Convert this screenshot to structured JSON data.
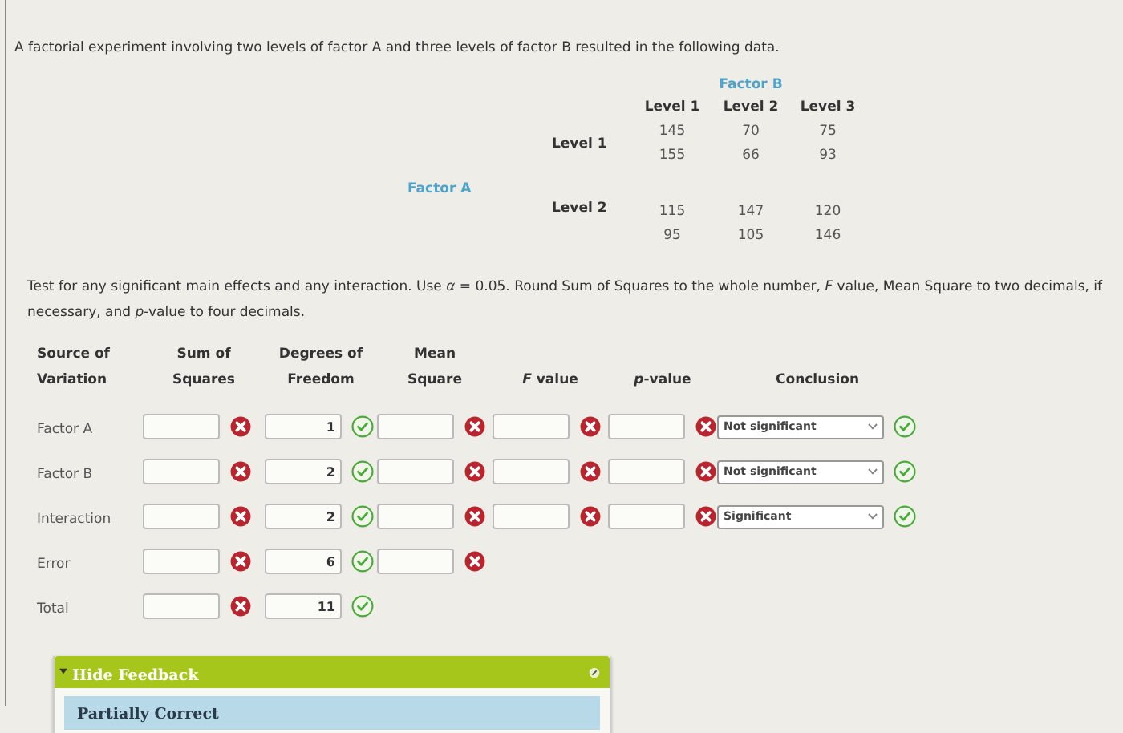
{
  "intro": "A factorial experiment involving two levels of factor A and three levels of factor B resulted in the following data.",
  "data_table": {
    "factor_b_label": "Factor B",
    "factor_a_label": "Factor A",
    "column_headers": [
      "Level 1",
      "Level 2",
      "Level 3"
    ],
    "rows": [
      {
        "label": "Level 1",
        "lines": [
          [
            "145",
            "70",
            "75"
          ],
          [
            "155",
            "66",
            "93"
          ]
        ]
      },
      {
        "label": "Level 2",
        "lines": [
          [
            "115",
            "147",
            "120"
          ],
          [
            "95",
            "105",
            "146"
          ]
        ]
      }
    ]
  },
  "instructions": "Test for any significant main effects and any interaction. Use *α* = 0.05. Round Sum of Squares to the whole number, *F* value, Mean Square to two decimals, if necessary, and *p*-value to four decimals.",
  "anova": {
    "columns": [
      "Source of Variation",
      "Sum of Squares",
      "Degrees of Freedom",
      "Mean Square",
      "*F* value",
      "*p*-value",
      "Conclusion"
    ],
    "rows": [
      {
        "source": "Factor A",
        "cells": [
          {
            "kind": "input",
            "correct": false
          },
          {
            "kind": "input",
            "value": "1",
            "correct": true
          },
          {
            "kind": "input",
            "correct": false
          },
          {
            "kind": "input",
            "correct": false
          },
          {
            "kind": "input",
            "correct": false
          },
          {
            "kind": "select",
            "value": "Not significant",
            "correct": true
          }
        ]
      },
      {
        "source": "Factor B",
        "cells": [
          {
            "kind": "input",
            "correct": false
          },
          {
            "kind": "input",
            "value": "2",
            "correct": true
          },
          {
            "kind": "input",
            "correct": false
          },
          {
            "kind": "input",
            "correct": false
          },
          {
            "kind": "input",
            "correct": false
          },
          {
            "kind": "select",
            "value": "Not significant",
            "correct": true
          }
        ]
      },
      {
        "source": "Interaction",
        "cells": [
          {
            "kind": "input",
            "correct": false
          },
          {
            "kind": "input",
            "value": "2",
            "correct": true
          },
          {
            "kind": "input",
            "correct": false
          },
          {
            "kind": "input",
            "correct": false
          },
          {
            "kind": "input",
            "correct": false
          },
          {
            "kind": "select",
            "value": "Significant",
            "correct": true
          }
        ]
      },
      {
        "source": "Error",
        "cells": [
          {
            "kind": "input",
            "correct": false
          },
          {
            "kind": "input",
            "value": "6",
            "correct": true
          },
          {
            "kind": "input",
            "correct": false
          }
        ]
      },
      {
        "source": "Total",
        "cells": [
          {
            "kind": "input",
            "correct": false
          },
          {
            "kind": "input",
            "value": "11",
            "correct": true
          }
        ]
      }
    ]
  },
  "feedback": {
    "expanded": true,
    "toggle_label": "Hide Feedback",
    "message": "Partially Correct"
  }
}
